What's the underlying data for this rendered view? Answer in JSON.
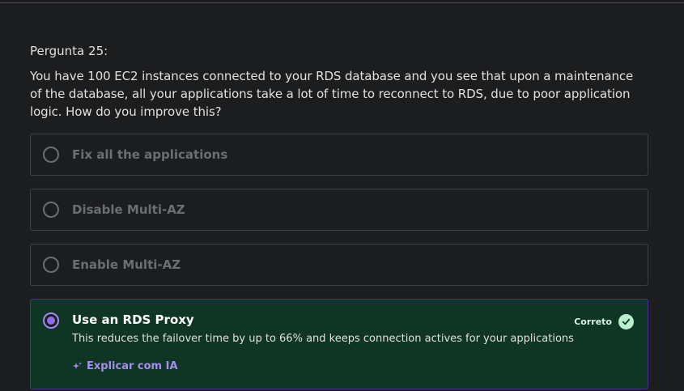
{
  "question": {
    "number_label": "Pergunta 25:",
    "text": "You have 100 EC2 instances connected to your RDS database and you see that upon a maintenance of the database, all your applications take a lot of time to reconnect to RDS, due to poor application logic. How do you improve this?"
  },
  "options": [
    {
      "label": "Fix all the applications",
      "selected": false
    },
    {
      "label": "Disable Multi-AZ",
      "selected": false
    },
    {
      "label": "Enable Multi-AZ",
      "selected": false
    },
    {
      "label": "Use an RDS Proxy",
      "selected": true,
      "status": "Correto",
      "explanation": "This reduces the failover time by up to 66% and keeps connection actives for your applications",
      "ai_link": "Explicar com IA"
    }
  ],
  "colors": {
    "background": "#1c1d1f",
    "correct_bg": "#0f3524",
    "correct_border": "#4b2b9d",
    "accent_purple": "#a58ef2",
    "check_green": "#b8f0cf"
  },
  "icons": {
    "status": "check-circle-icon",
    "ai": "sparkle-icon",
    "radio": "radio-icon"
  }
}
